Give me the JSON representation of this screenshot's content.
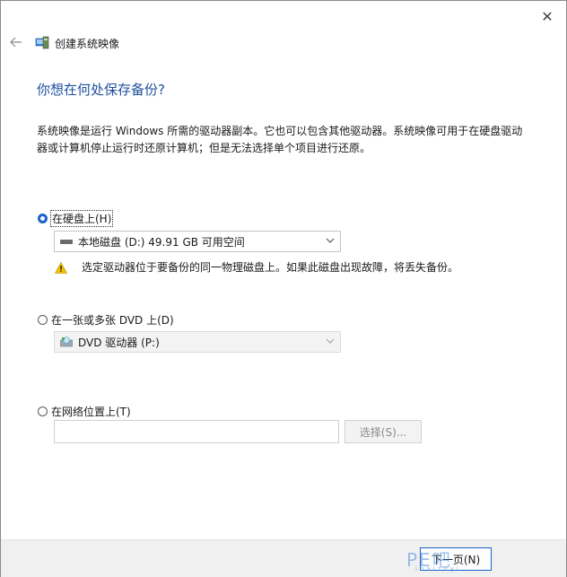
{
  "window": {
    "title": "创建系统映像",
    "close_glyph": "✕",
    "back_glyph": "←"
  },
  "heading": "你想在何处保存备份?",
  "description": "系统映像是运行 Windows 所需的驱动器副本。它也可以包含其他驱动器。系统映像可用于在硬盘驱动器或计算机停止运行时还原计算机；但是无法选择单个项目进行还原。",
  "options": {
    "hard_disk": {
      "label": "在硬盘上(H)",
      "checked": true,
      "selected_value": "本地磁盘 (D:)  49.91 GB 可用空间",
      "warning": "选定驱动器位于要备份的同一物理磁盘上。如果此磁盘出现故障，将丢失备份。"
    },
    "dvd": {
      "label": "在一张或多张 DVD 上(D)",
      "checked": false,
      "selected_value": "DVD 驱动器 (P:)"
    },
    "network": {
      "label": "在网络位置上(T)",
      "checked": false,
      "input_value": "",
      "select_button": "选择(S)..."
    }
  },
  "footer": {
    "next_button": "下一页(N)",
    "watermark": "PE吧",
    "watermark_sub": "ibaizuyi"
  },
  "colors": {
    "heading": "#1e4f9c",
    "accent": "#1a63c7",
    "warning": "#f2c200"
  }
}
